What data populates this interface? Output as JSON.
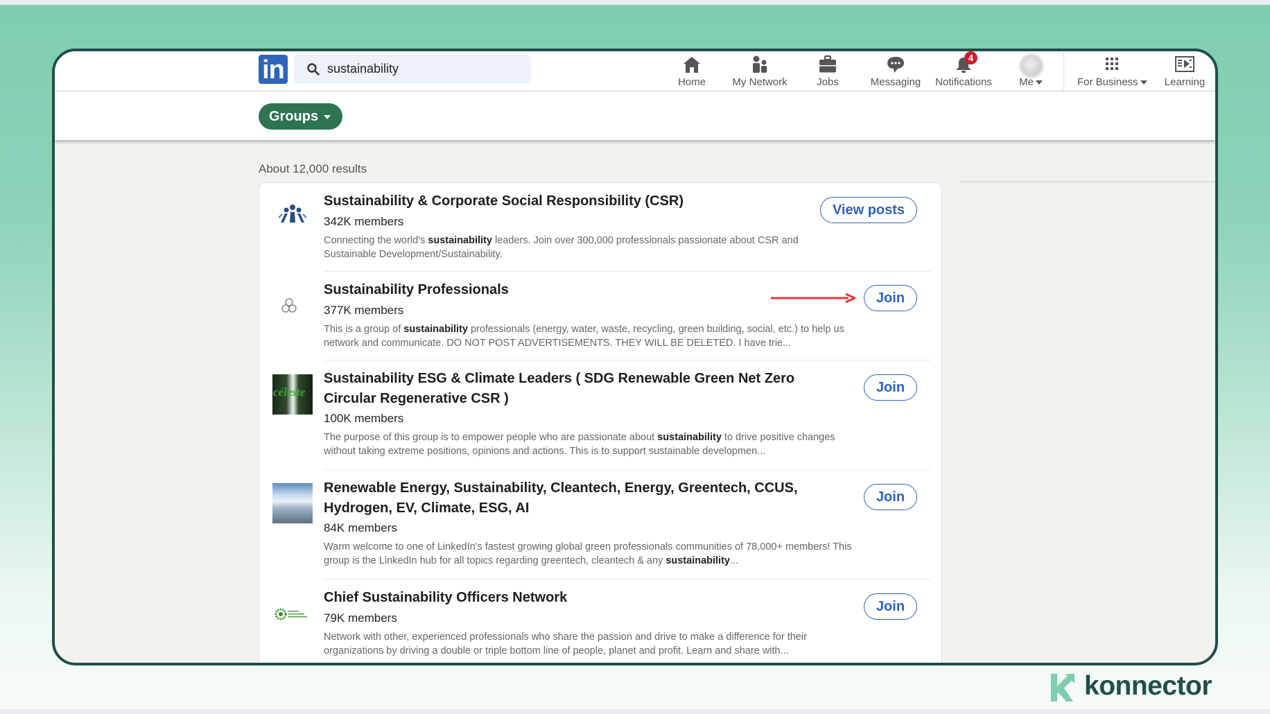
{
  "nav": {
    "logo_text": "in",
    "search": {
      "value": "sustainability",
      "placeholder": "Search"
    },
    "items": [
      {
        "label": "Home",
        "icon": "home-icon"
      },
      {
        "label": "My Network",
        "icon": "network-icon"
      },
      {
        "label": "Jobs",
        "icon": "briefcase-icon"
      },
      {
        "label": "Messaging",
        "icon": "messaging-icon"
      },
      {
        "label": "Notifications",
        "icon": "bell-icon",
        "badge": "4"
      },
      {
        "label": "Me",
        "icon": "avatar"
      },
      {
        "label": "For Business",
        "icon": "grid-icon"
      },
      {
        "label": "Learning",
        "icon": "learning-icon"
      }
    ]
  },
  "filter": {
    "label": "Groups"
  },
  "results": {
    "count_text": "About 12,000 results",
    "groups": [
      {
        "title": "Sustainability & Corporate Social Responsibility (CSR)",
        "members": "342K members",
        "desc_before": "Connecting the world's ",
        "desc_bold": "sustainability",
        "desc_after": " leaders. Join over 300,000 professionals passionate about CSR and Sustainable Development/Sustainability.",
        "action": "View posts"
      },
      {
        "title": "Sustainability Professionals",
        "members": "377K members",
        "desc_before": "This is a group of ",
        "desc_bold": "sustainability",
        "desc_after": " professionals (energy, water, waste, recycling, green building, social, etc.) to help us network and communicate. DO NOT POST ADVERTISEMENTS. THEY WILL BE DELETED. I have trie...",
        "action": "Join"
      },
      {
        "title": "Sustainability ESG & Climate Leaders ( SDG Renewable Green Net Zero Circular Regenerative CSR )",
        "members": "100K members",
        "desc_before": "The purpose of this group is to empower people who are passionate about ",
        "desc_bold": "sustainability",
        "desc_after": " to drive positive changes without taking extreme positions, opinions and actions. This is to support sustainable developmen...",
        "action": "Join",
        "thumb_text": "céleste"
      },
      {
        "title": "Renewable Energy, Sustainability, Cleantech, Energy, Greentech, CCUS, Hydrogen, EV, Climate, ESG, AI",
        "members": "84K members",
        "desc_before": "Warm welcome to one of LinkedIn's fastest growing global green professionals communities of 78,000+ members! This group is the LinkedIn hub for all topics regarding greentech, cleantech & any ",
        "desc_bold": "sustainability",
        "desc_after": "...",
        "action": "Join"
      },
      {
        "title": "Chief Sustainability Officers Network",
        "members": "79K members",
        "desc_before": "Network with other, experienced professionals who share the passion and drive to make a difference for their organizations by driving a double or triple bottom line of people, planet and profit. Learn and share with...",
        "desc_bold": "",
        "desc_after": "",
        "action": "Join"
      }
    ]
  },
  "branding": {
    "name": "konnector"
  },
  "colors": {
    "linkedin_blue": "#2d64bc",
    "groups_pill": "#2f7452",
    "frame_border": "#1f4f4a",
    "annotation_arrow": "#e0393e",
    "notification_badge": "#cb1f2c"
  }
}
